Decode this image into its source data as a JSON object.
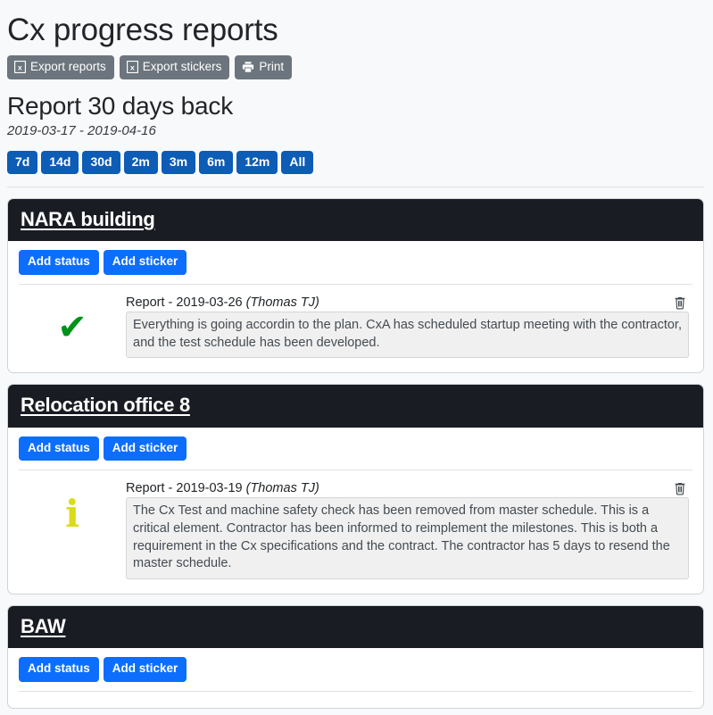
{
  "header": {
    "title": "Cx progress reports",
    "toolbar": [
      {
        "label": "Export reports",
        "icon": "excel-file-icon"
      },
      {
        "label": "Export stickers",
        "icon": "excel-file-icon"
      },
      {
        "label": "Print",
        "icon": "printer-icon"
      }
    ]
  },
  "report": {
    "subtitle": "Report 30 days back",
    "date_range": "2019-03-17 - 2019-04-16",
    "ranges": [
      {
        "label": "7d"
      },
      {
        "label": "14d"
      },
      {
        "label": "30d"
      },
      {
        "label": "2m"
      },
      {
        "label": "3m"
      },
      {
        "label": "6m"
      },
      {
        "label": "12m"
      },
      {
        "label": "All"
      }
    ]
  },
  "actions": {
    "add_status": "Add status",
    "add_sticker": "Add sticker",
    "delete_icon": "trash-icon"
  },
  "colors": {
    "accent_blue": "#0d6efd",
    "range_blue": "#0d5cb6",
    "toolbar_grey": "#6c757d",
    "card_header": "#191c22",
    "status_ok_green": "#009118",
    "status_info_yellow": "#dbdb16",
    "page_bg": "#f8f9fa"
  },
  "projects": [
    {
      "name": "NARA building",
      "entries": [
        {
          "status_icon": "check-mark-icon",
          "label": "Report - 2019-03-26",
          "author": "(Thomas TJ)",
          "text": "Everything is going accordin to the plan. CxA has scheduled startup meeting with the contractor, and the test schedule has been developed."
        }
      ]
    },
    {
      "name": "Relocation office 8",
      "entries": [
        {
          "status_icon": "info-icon",
          "label": "Report - 2019-03-19",
          "author": "(Thomas TJ)",
          "text": "The Cx Test and machine safety check has been removed from master schedule. This is a critical element. Contractor has been informed to reimplement the milestones. This is both a requirement in the Cx specifications and the contract. The contractor has 5 days to resend the master schedule."
        }
      ]
    },
    {
      "name": "BAW",
      "entries": []
    }
  ]
}
